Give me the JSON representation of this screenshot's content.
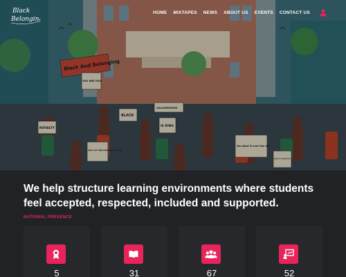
{
  "logo": {
    "text": "Black Belonging"
  },
  "nav": {
    "links": [
      "HOME",
      "MIXTAPES",
      "NEWS",
      "ABOUT US",
      "EVENTS",
      "CONTACT US"
    ]
  },
  "hero": {
    "banner_sign": "Black And Belonging",
    "signs": [
      "YOU ARE YOU!",
      "ROYALTY",
      "BLACK",
      "IS KING",
      "DON'T LET THESE DEGREES FOOL YOU",
      "You About To Lose Your Job",
      "BLACK IS BEAUTIFUL",
      "BLACK BELONGING",
      "#ALLWEHAVEIS"
    ]
  },
  "headline": "We help structure learning environments where students feel accepted, respected, included and supported.",
  "section_label": "NATIONAL PRESENCE",
  "stats": [
    {
      "icon": "award-icon",
      "value": "5"
    },
    {
      "icon": "book-icon",
      "value": "31"
    },
    {
      "icon": "group-icon",
      "value": "67"
    },
    {
      "icon": "teacher-icon",
      "value": "52"
    }
  ],
  "colors": {
    "accent": "#e8245b",
    "background": "#202226",
    "card": "#26282c"
  }
}
